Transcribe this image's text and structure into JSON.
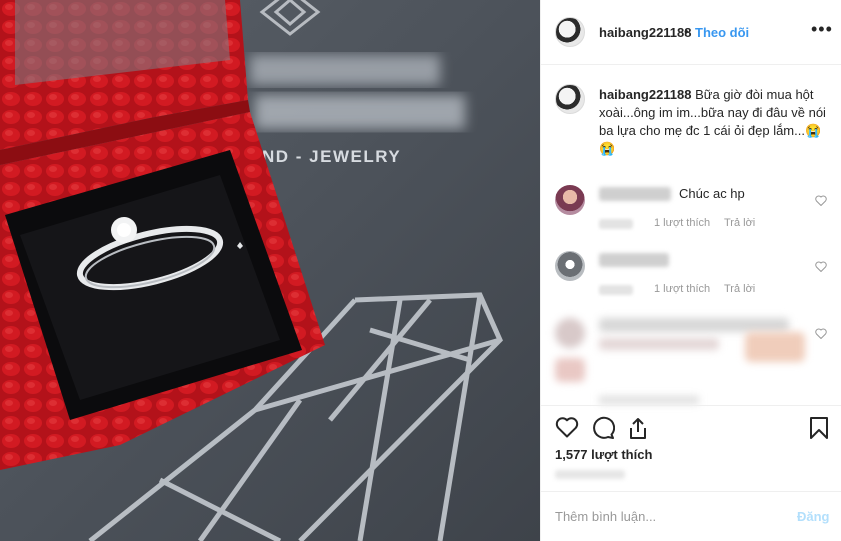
{
  "post": {
    "username": "haibang221188",
    "separator": "•",
    "follow_label": "Theo dõi",
    "more_label": "•••",
    "caption_user": "haibang221188",
    "caption_text": " Bữa giờ đòi mua hột xoài...ông im im...bữa nay đi đâu về nói ba lựa cho mẹ đc 1 cái ỏi đẹp lắm...😭😭",
    "photo_text": "ND - JEWELRY"
  },
  "comments": [
    {
      "text": "Chúc ac hp",
      "likes": "1 lượt thích",
      "reply": "Trả lời"
    },
    {
      "text": "",
      "likes": "1 lượt thích",
      "reply": "Trả lời"
    }
  ],
  "actions": {
    "likes_count": "1,577 lượt thích",
    "icons": [
      "heart-icon",
      "comment-icon",
      "share-icon",
      "bookmark-icon"
    ]
  },
  "comment_box": {
    "placeholder": "Thêm bình luận...",
    "post_label": "Đăng"
  },
  "colors": {
    "link": "#3897f0",
    "post_disabled": "#b2dffc",
    "box_red": "#c0141a"
  }
}
